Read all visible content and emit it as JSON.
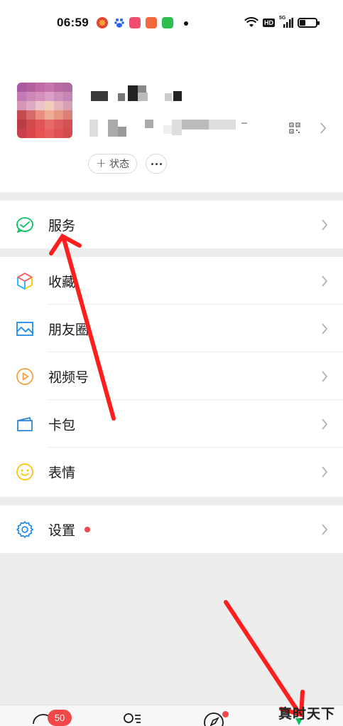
{
  "status_bar": {
    "time": "06:59",
    "network_label": "5G",
    "hd_label": "HD",
    "battery_level": 0.35
  },
  "profile": {
    "status_button_plus": "+",
    "status_button_label": "状态"
  },
  "menu": {
    "service": {
      "label": "服务",
      "icon": "wechat-pay-check-icon"
    },
    "items": [
      {
        "label": "收藏",
        "icon": "favorites-cube-icon"
      },
      {
        "label": "朋友圈",
        "icon": "moments-image-icon"
      },
      {
        "label": "视频号",
        "icon": "channels-play-icon"
      },
      {
        "label": "卡包",
        "icon": "card-wallet-icon"
      },
      {
        "label": "表情",
        "icon": "sticker-smile-icon"
      }
    ],
    "settings": {
      "label": "设置",
      "icon": "gear-icon",
      "has_red_dot": true
    }
  },
  "bottom_nav": {
    "chats_badge": "50",
    "discover_red_dot": true
  },
  "watermark": "真时天下",
  "colors": {
    "accent_green": "#07c160",
    "badge_red": "#f04848",
    "annotation_red": "#ff1d1d",
    "background": "#ededed"
  }
}
